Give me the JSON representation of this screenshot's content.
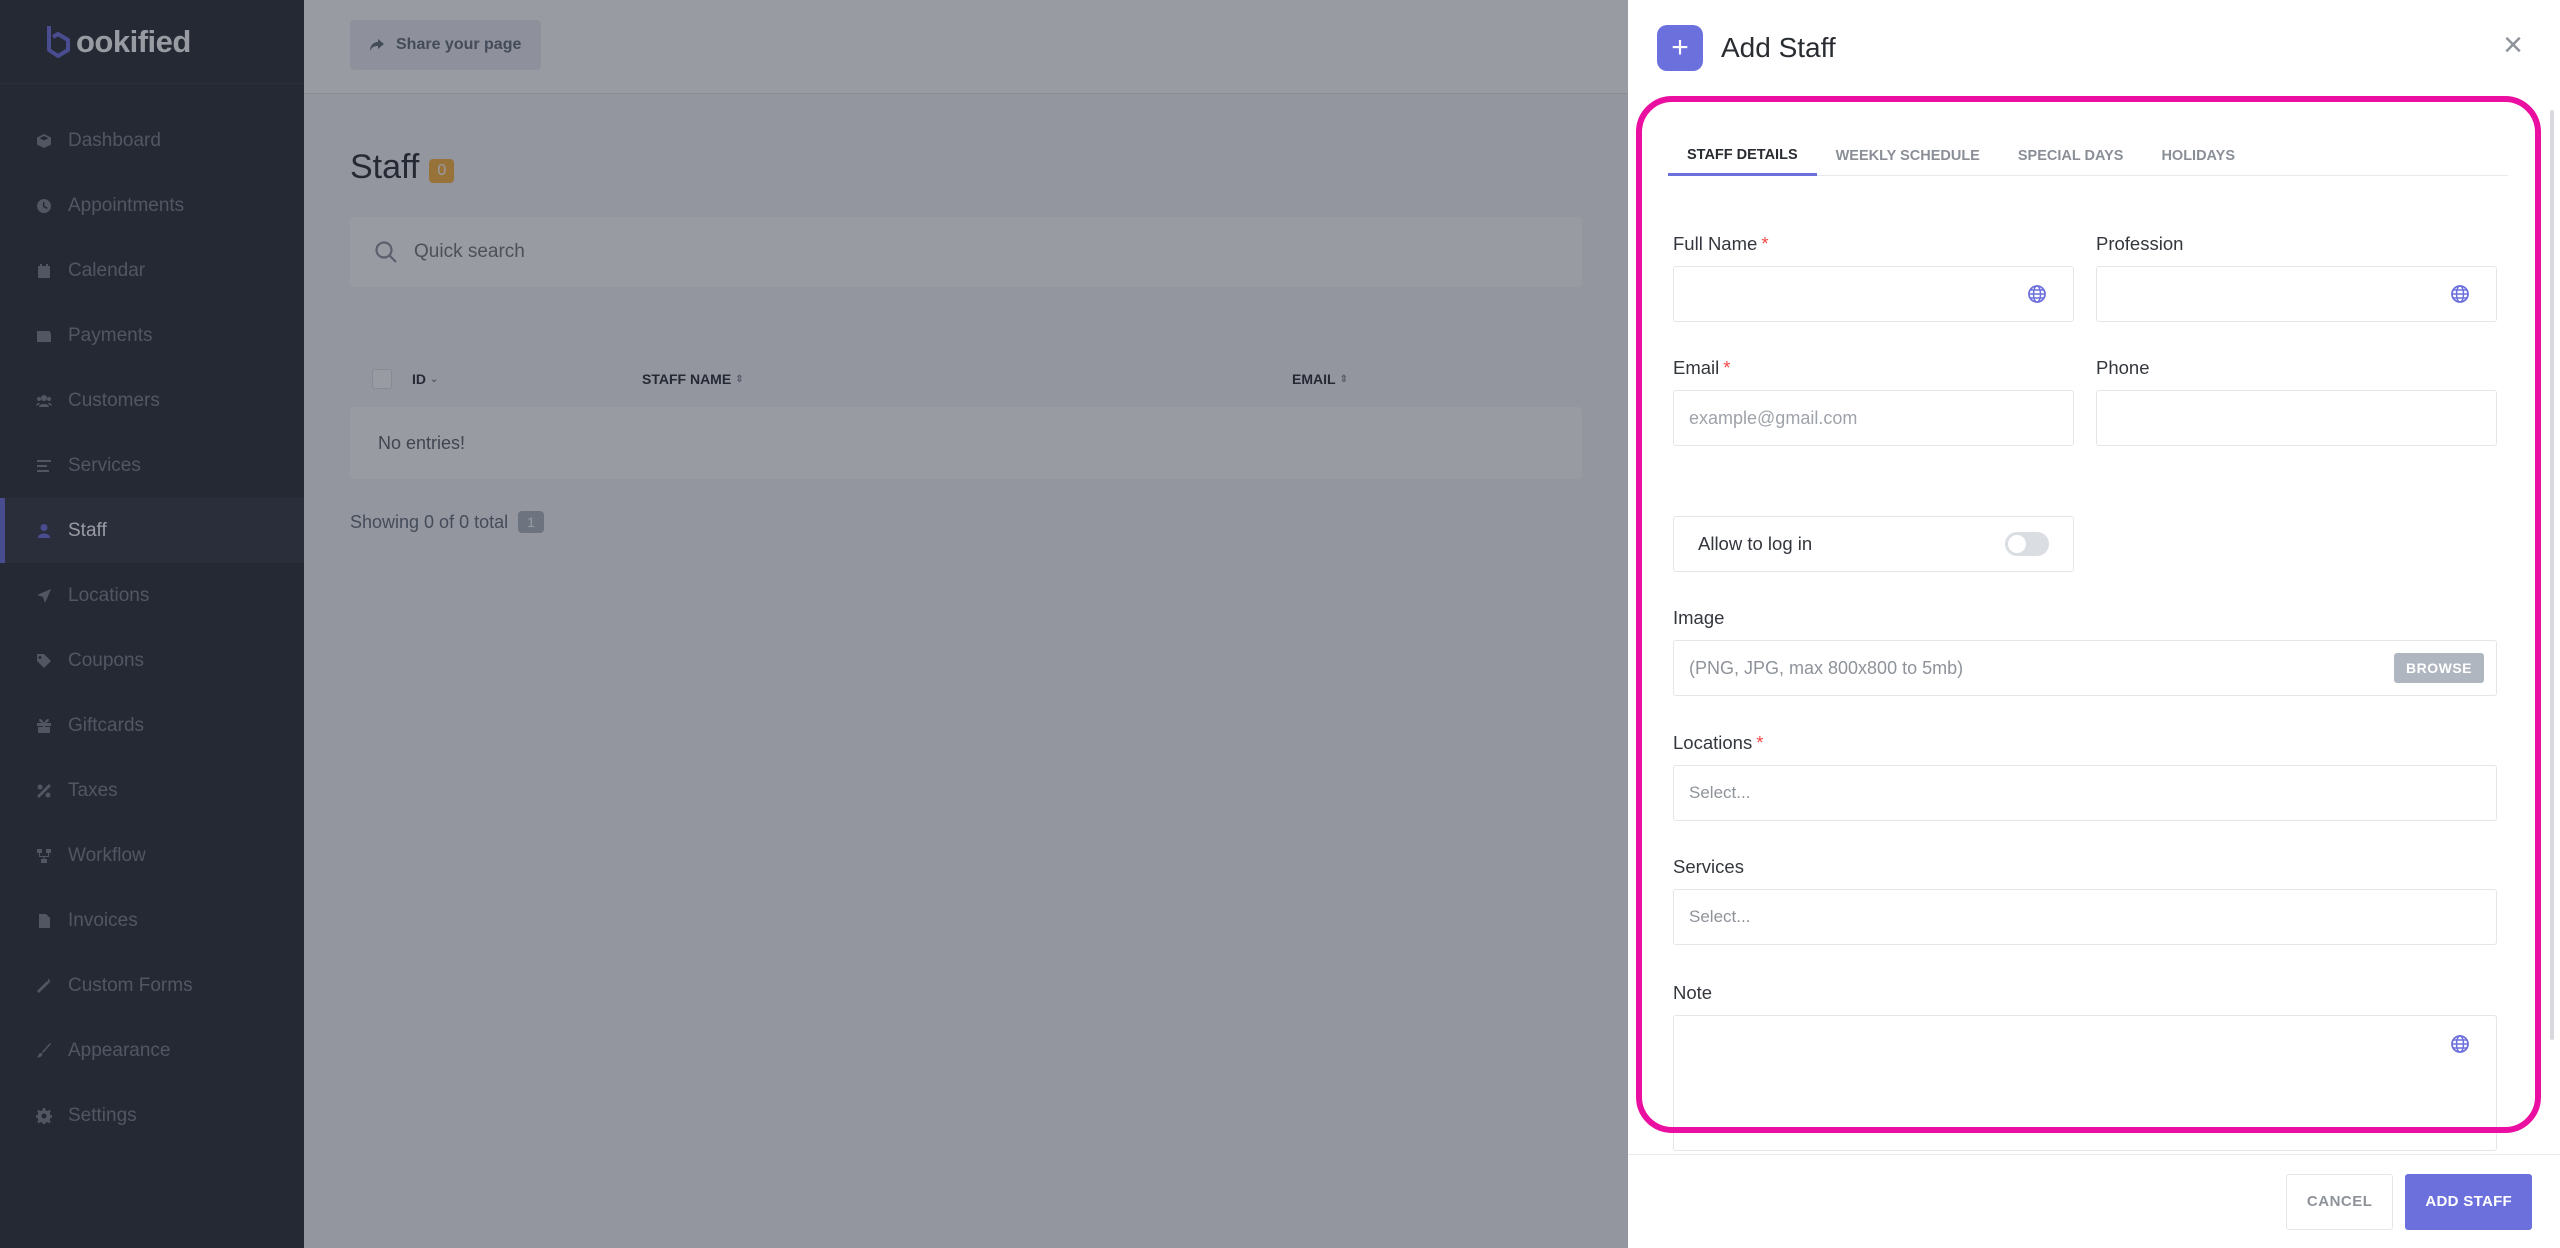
{
  "brand": {
    "logo_text": "ookified",
    "accent_color": "#6c70dc"
  },
  "sidebar": {
    "items": [
      {
        "label": "Dashboard",
        "icon": "cube-icon"
      },
      {
        "label": "Appointments",
        "icon": "clock-icon"
      },
      {
        "label": "Calendar",
        "icon": "calendar-icon"
      },
      {
        "label": "Payments",
        "icon": "wallet-icon"
      },
      {
        "label": "Customers",
        "icon": "users-icon"
      },
      {
        "label": "Services",
        "icon": "list-icon"
      },
      {
        "label": "Staff",
        "icon": "user-icon",
        "active": true
      },
      {
        "label": "Locations",
        "icon": "location-arrow-icon"
      },
      {
        "label": "Coupons",
        "icon": "tag-icon"
      },
      {
        "label": "Giftcards",
        "icon": "gift-icon"
      },
      {
        "label": "Taxes",
        "icon": "percent-icon"
      },
      {
        "label": "Workflow",
        "icon": "workflow-icon"
      },
      {
        "label": "Invoices",
        "icon": "file-icon"
      },
      {
        "label": "Custom Forms",
        "icon": "magic-wand-icon"
      },
      {
        "label": "Appearance",
        "icon": "brush-icon"
      },
      {
        "label": "Settings",
        "icon": "gear-icon"
      }
    ]
  },
  "main": {
    "share_label": "Share your page",
    "title": "Staff",
    "count": "0",
    "search_placeholder": "Quick search",
    "columns": {
      "id": "ID",
      "staff_name": "STAFF NAME",
      "email": "EMAIL"
    },
    "empty_text": "No entries!",
    "showing_text": "Showing 0 of 0 total",
    "page": "1"
  },
  "modal": {
    "title": "Add Staff",
    "tabs": [
      "STAFF DETAILS",
      "WEEKLY SCHEDULE",
      "SPECIAL DAYS",
      "HOLIDAYS"
    ],
    "active_tab": "STAFF DETAILS",
    "fields": {
      "full_name_label": "Full Name",
      "profession_label": "Profession",
      "email_label": "Email",
      "email_placeholder": "example@gmail.com",
      "phone_label": "Phone",
      "allow_login_label": "Allow to log in",
      "allow_login_on": false,
      "image_label": "Image",
      "image_hint": "(PNG, JPG, max 800x800 to 5mb)",
      "browse_label": "BROWSE",
      "locations_label": "Locations",
      "locations_placeholder": "Select...",
      "services_label": "Services",
      "services_placeholder": "Select...",
      "note_label": "Note",
      "required_mark": "*"
    },
    "footer": {
      "cancel_label": "CANCEL",
      "add_label": "ADD STAFF"
    },
    "highlight_color": "#ea0fa0"
  }
}
